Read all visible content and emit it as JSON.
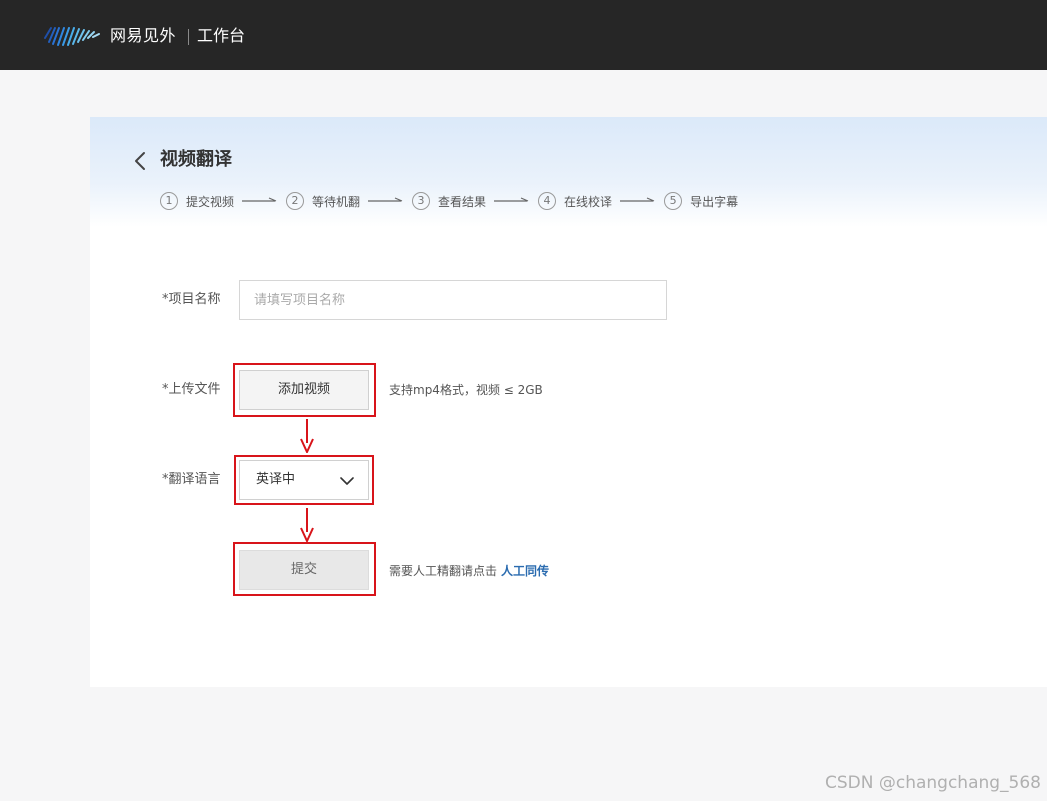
{
  "topbar": {
    "brand": "网易见外",
    "workspace": "工作台",
    "logo_icon": "waveform-logo-icon"
  },
  "page": {
    "title": "视频翻译",
    "back_icon": "chevron-left-icon"
  },
  "steps": [
    {
      "num": "1",
      "label": "提交视频"
    },
    {
      "num": "2",
      "label": "等待机翻"
    },
    {
      "num": "3",
      "label": "查看结果"
    },
    {
      "num": "4",
      "label": "在线校译"
    },
    {
      "num": "5",
      "label": "导出字幕"
    }
  ],
  "form": {
    "project_name": {
      "label": "*项目名称",
      "placeholder": "请填写项目名称",
      "value": ""
    },
    "upload": {
      "label": "*上传文件",
      "button": "添加视频",
      "hint": "支持mp4格式，视频 ≤ 2GB"
    },
    "language": {
      "label": "*翻译语言",
      "selected": "英译中",
      "icon": "chevron-down-icon"
    },
    "submit": {
      "button": "提交",
      "hint": "需要人工精翻请点击",
      "link": "人工同传"
    }
  },
  "colors": {
    "topbar": "#262626",
    "annotation_red": "#d8141a",
    "link_blue": "#2b6cb0"
  },
  "watermark": "CSDN @changchang_568"
}
